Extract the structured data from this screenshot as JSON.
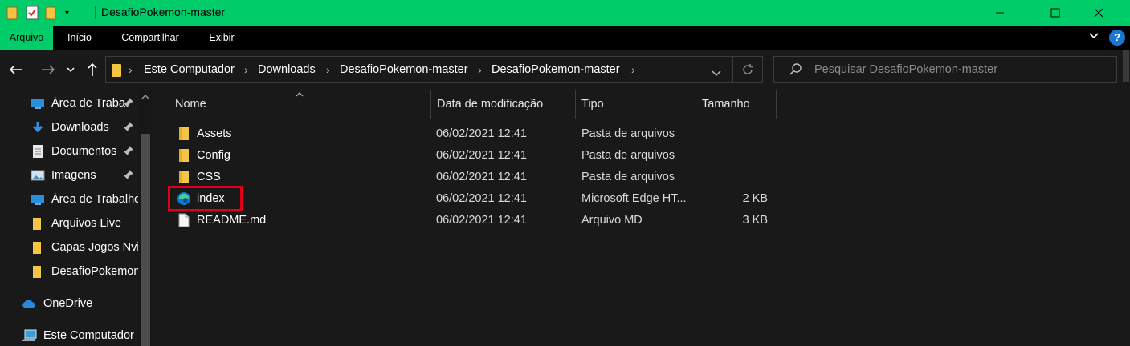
{
  "window": {
    "title": "DesafioPokemon-master"
  },
  "ribbon": {
    "tabs": [
      {
        "label": "Arquivo",
        "active": true
      },
      {
        "label": "Início",
        "active": false
      },
      {
        "label": "Compartilhar",
        "active": false
      },
      {
        "label": "Exibir",
        "active": false
      }
    ],
    "help_label": "?"
  },
  "address": {
    "crumbs": [
      "Este Computador",
      "Downloads",
      "DesafioPokemon-master",
      "DesafioPokemon-master"
    ]
  },
  "search": {
    "placeholder": "Pesquisar DesafioPokemon-master"
  },
  "sidebar": {
    "items": [
      {
        "label": "Área de Traba",
        "icon": "desktop-icon",
        "pinned": true
      },
      {
        "label": "Downloads",
        "icon": "download-icon",
        "pinned": true
      },
      {
        "label": "Documentos",
        "icon": "document-icon",
        "pinned": true
      },
      {
        "label": "Imagens",
        "icon": "image-icon",
        "pinned": true
      },
      {
        "label": "Área de Trabalho",
        "icon": "desktop-icon",
        "pinned": false
      },
      {
        "label": "Arquivos Live",
        "icon": "folder-icon",
        "pinned": false
      },
      {
        "label": "Capas Jogos Nvi",
        "icon": "folder-icon",
        "pinned": false
      },
      {
        "label": "DesafioPokemon",
        "icon": "folder-icon",
        "pinned": false
      },
      {
        "label": "OneDrive",
        "icon": "cloud-icon",
        "pinned": false
      },
      {
        "label": "Este Computador",
        "icon": "computer-icon",
        "pinned": false
      }
    ]
  },
  "columns": {
    "name": "Nome",
    "date": "Data de modificação",
    "type": "Tipo",
    "size": "Tamanho"
  },
  "files": [
    {
      "name": "Assets",
      "date": "06/02/2021 12:41",
      "type": "Pasta de arquivos",
      "size": "",
      "icon": "folder-icon"
    },
    {
      "name": "Config",
      "date": "06/02/2021 12:41",
      "type": "Pasta de arquivos",
      "size": "",
      "icon": "folder-icon"
    },
    {
      "name": "CSS",
      "date": "06/02/2021 12:41",
      "type": "Pasta de arquivos",
      "size": "",
      "icon": "folder-icon"
    },
    {
      "name": "index",
      "date": "06/02/2021 12:41",
      "type": "Microsoft Edge HT...",
      "size": "2 KB",
      "icon": "edge-icon"
    },
    {
      "name": "README.md",
      "date": "06/02/2021 12:41",
      "type": "Arquivo MD",
      "size": "3 KB",
      "icon": "file-icon"
    }
  ],
  "colors": {
    "accent": "#00cc6a",
    "highlight": "#e0001b",
    "background": "#191919"
  }
}
